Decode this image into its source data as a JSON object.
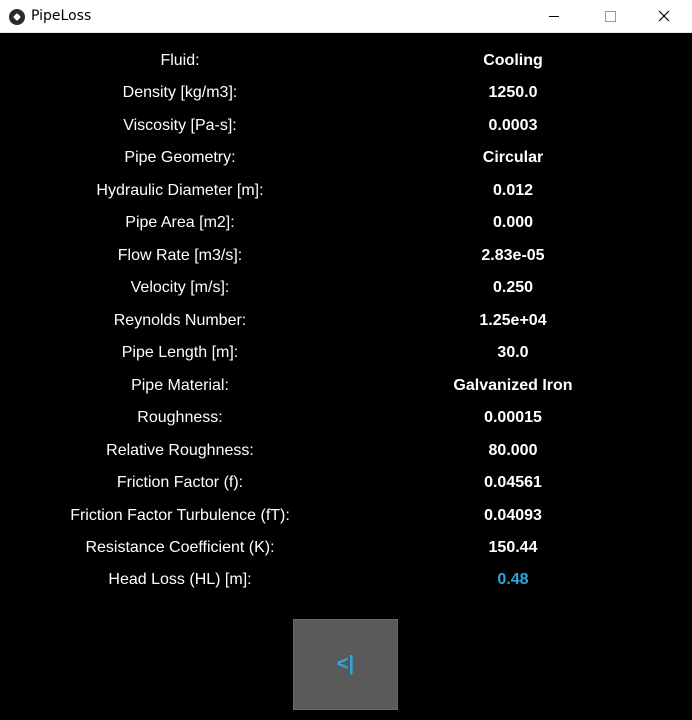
{
  "window": {
    "title": "PipeLoss",
    "icon": "kivy-app-icon"
  },
  "results": [
    {
      "label": "Fluid:",
      "value": "Cooling"
    },
    {
      "label": "Density [kg/m3]:",
      "value": "1250.0"
    },
    {
      "label": "Viscosity [Pa-s]:",
      "value": "0.0003"
    },
    {
      "label": "Pipe Geometry:",
      "value": "Circular"
    },
    {
      "label": "Hydraulic Diameter [m]:",
      "value": "0.012"
    },
    {
      "label": "Pipe Area [m2]:",
      "value": "0.000"
    },
    {
      "label": "Flow Rate [m3/s]:",
      "value": "2.83e-05"
    },
    {
      "label": "Velocity [m/s]:",
      "value": "0.250"
    },
    {
      "label": "Reynolds Number:",
      "value": "1.25e+04"
    },
    {
      "label": "Pipe Length [m]:",
      "value": "30.0"
    },
    {
      "label": "Pipe Material:",
      "value": "Galvanized Iron"
    },
    {
      "label": "Roughness:",
      "value": "0.00015"
    },
    {
      "label": "Relative Roughness:",
      "value": "80.000"
    },
    {
      "label": "Friction Factor (f):",
      "value": "0.04561"
    },
    {
      "label": "Friction Factor Turbulence (fT):",
      "value": "0.04093"
    },
    {
      "label": "Resistance Coefficient (K):",
      "value": "150.44"
    },
    {
      "label": "Head Loss (HL) [m]:",
      "value": "0.48"
    }
  ],
  "back_button": {
    "label": "<|"
  },
  "colors": {
    "background": "#000000",
    "text": "#ffffff",
    "accent": "#2aa8e0",
    "button": "#5a5a5a"
  }
}
